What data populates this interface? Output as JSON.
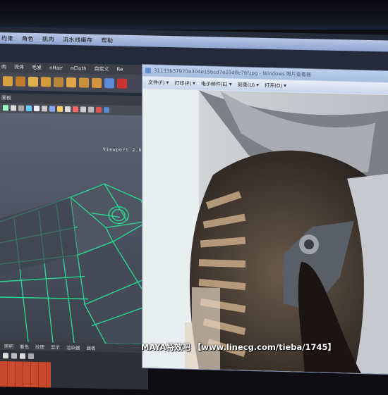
{
  "maya": {
    "menus": [
      "约束",
      "角色",
      "肌肉",
      "流水线缓存",
      "帮助"
    ],
    "shelf_tabs": [
      "肉",
      "流体",
      "毛发",
      "nHair",
      "nCloth",
      "自定义",
      "Re"
    ],
    "toolbar_label": "面板",
    "viewport_label": "Viewport 2.0",
    "timeline_tabs": [
      "照明",
      "着色",
      "纹理",
      "显示",
      "渲染器",
      "面板"
    ]
  },
  "viewer": {
    "title": "31133b37970a304e15bcd7e03d8e76f.jpg - Windows 照片查看器",
    "menus": [
      {
        "label": "文件(F)"
      },
      {
        "label": "打印(P)"
      },
      {
        "label": "电子邮件(E)"
      },
      {
        "label": "刻录(U)"
      },
      {
        "label": "打开(O)"
      }
    ]
  },
  "watermark": "MAYA特效吧 【www.linecg.com/tieba/1745】",
  "colors": {
    "wireframe": "#2bd68f",
    "maya_menubar": "#a9b9dd",
    "viewer_chrome": "#c8d6ec",
    "timeline_red": "#c9492e"
  }
}
